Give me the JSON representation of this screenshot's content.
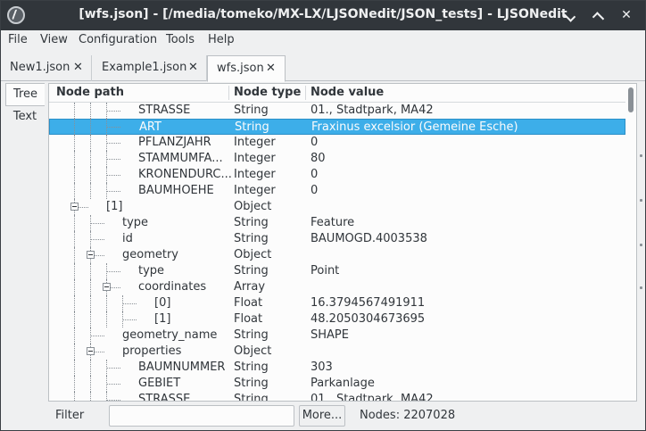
{
  "window": {
    "title": "[wfs.json] - [/media/tomeko/MX-LX/LJSONedit/JSON_tests] - LJSONedit",
    "app_icon": "ljsonedit-icon",
    "controls": [
      "minimize-icon",
      "maximize-icon",
      "close-icon"
    ]
  },
  "menu": [
    "File",
    "View",
    "Configuration",
    "Tools",
    "Help"
  ],
  "tabs": [
    {
      "label": "New1.json",
      "active": false
    },
    {
      "label": "Example1.json",
      "active": false
    },
    {
      "label": "wfs.json",
      "active": true
    }
  ],
  "side_tabs": [
    {
      "label": "Tree",
      "active": true
    },
    {
      "label": "Text",
      "active": false
    }
  ],
  "columns": {
    "path": "Node path",
    "type": "Node type",
    "value": "Node value"
  },
  "rows": [
    {
      "name": "STRASSE",
      "type": "String",
      "value": "01., Stadtpark, MA42",
      "depth": 3,
      "selected": false
    },
    {
      "name": "ART",
      "type": "String",
      "value": "Fraxinus excelsior (Gemeine Esche)",
      "depth": 3,
      "selected": true
    },
    {
      "name": "PFLANZJAHR",
      "type": "Integer",
      "value": "0",
      "depth": 3,
      "selected": false
    },
    {
      "name": "STAMMUMFA...",
      "type": "Integer",
      "value": "80",
      "depth": 3,
      "selected": false
    },
    {
      "name": "KRONENDURC...",
      "type": "Integer",
      "value": "0",
      "depth": 3,
      "selected": false
    },
    {
      "name": "BAUMHOEHE",
      "type": "Integer",
      "value": "0",
      "depth": 3,
      "selected": false
    },
    {
      "name": "[1]",
      "type": "Object",
      "value": "",
      "depth": 1,
      "selected": false
    },
    {
      "name": "type",
      "type": "String",
      "value": "Feature",
      "depth": 2,
      "selected": false
    },
    {
      "name": "id",
      "type": "String",
      "value": "BAUMOGD.4003538",
      "depth": 2,
      "selected": false
    },
    {
      "name": "geometry",
      "type": "Object",
      "value": "",
      "depth": 2,
      "selected": false
    },
    {
      "name": "type",
      "type": "String",
      "value": "Point",
      "depth": 3,
      "selected": false
    },
    {
      "name": "coordinates",
      "type": "Array",
      "value": "",
      "depth": 3,
      "selected": false
    },
    {
      "name": "[0]",
      "type": "Float",
      "value": "16.3794567491911",
      "depth": 4,
      "selected": false
    },
    {
      "name": "[1]",
      "type": "Float",
      "value": "48.2050304673695",
      "depth": 4,
      "selected": false
    },
    {
      "name": "geometry_name",
      "type": "String",
      "value": "SHAPE",
      "depth": 2,
      "selected": false
    },
    {
      "name": "properties",
      "type": "Object",
      "value": "",
      "depth": 2,
      "selected": false
    },
    {
      "name": "BAUMNUMMER",
      "type": "String",
      "value": "303",
      "depth": 3,
      "selected": false
    },
    {
      "name": "GEBIET",
      "type": "String",
      "value": "Parkanlage",
      "depth": 3,
      "selected": false
    },
    {
      "name": "STRASSE",
      "type": "String",
      "value": "01., Stadtpark, MA42",
      "depth": 3,
      "selected": false
    }
  ],
  "bottom": {
    "filter_label": "Filter",
    "filter_value": "",
    "more_label": "More...",
    "nodes_label": "Nodes: 2207028"
  },
  "colors": {
    "titlebar": "#31363b",
    "selection": "#3daee9",
    "background": "#eff0f1"
  }
}
